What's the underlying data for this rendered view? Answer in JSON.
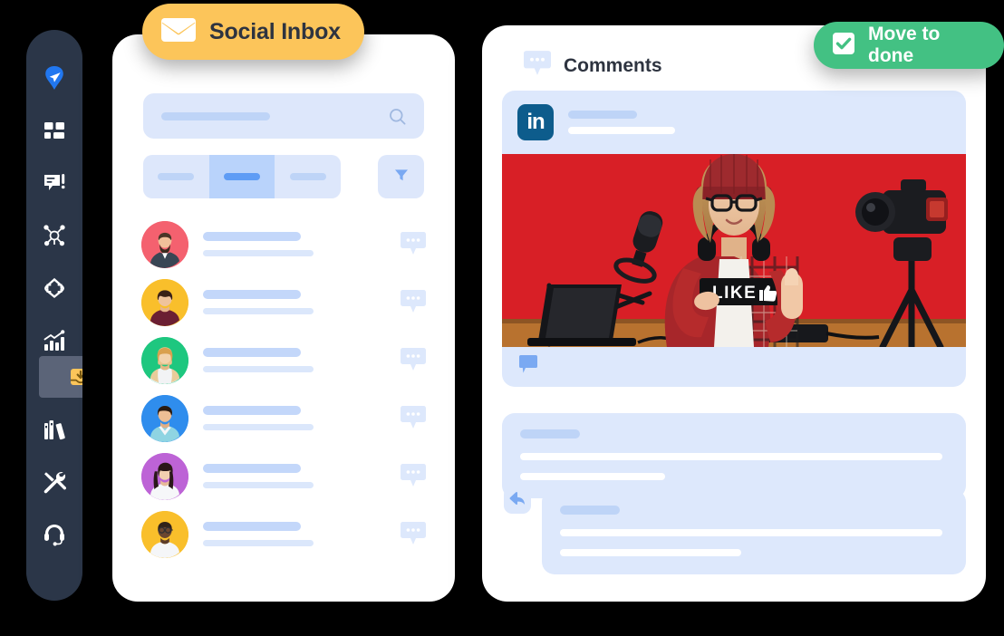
{
  "app": {
    "background_color": "#000000",
    "sidebar_color": "#2b3648",
    "sidebar_active_color": "#5b6478",
    "accent_yellow": "#fcc55a",
    "accent_green": "#43c183",
    "accent_blue": "#5e9cf5",
    "placeholder_blue": "#dde7fb"
  },
  "sidebar": {
    "name": "app-navigation-rail",
    "items": [
      {
        "icon": "paper-plane-icon",
        "label": "Publish",
        "active": false
      },
      {
        "icon": "dashboard-grid-icon",
        "label": "Dashboard",
        "active": false
      },
      {
        "icon": "comment-alert-icon",
        "label": "Engage",
        "active": false
      },
      {
        "icon": "network-nodes-icon",
        "label": "Network",
        "active": false
      },
      {
        "icon": "diamond-arrows-icon",
        "label": "Campaigns",
        "active": false
      },
      {
        "icon": "bar-chart-growth-icon",
        "label": "Analytics",
        "active": false
      },
      {
        "icon": "inbox-download-icon",
        "label": "Social Inbox",
        "active": true
      },
      {
        "icon": "books-library-icon",
        "label": "Library",
        "active": false
      },
      {
        "icon": "tools-wrench-icon",
        "label": "Tools",
        "active": false
      },
      {
        "icon": "headset-support-icon",
        "label": "Support",
        "active": false
      }
    ]
  },
  "inbox_badge": {
    "label": "Social Inbox",
    "icon": "envelope-icon"
  },
  "done_badge": {
    "label": "Move to done",
    "icon": "checkbox-checked-icon"
  },
  "left_panel": {
    "search": {
      "placeholder": "",
      "icon": "search-icon"
    },
    "tabs": [
      {
        "label": "",
        "active": false
      },
      {
        "label": "",
        "active": true
      },
      {
        "label": "",
        "active": false
      }
    ],
    "filter_button": {
      "label": "",
      "icon": "filter-funnel-icon"
    },
    "rows": [
      {
        "avatar": "avatar-bearded-man",
        "ring": "#f4616f",
        "title": "",
        "subtitle": "",
        "action_icon": "comment-bubble-icon"
      },
      {
        "avatar": "avatar-curly-hair-man",
        "ring": "#f9bf2b",
        "title": "",
        "subtitle": "",
        "action_icon": "comment-bubble-icon"
      },
      {
        "avatar": "avatar-blonde-woman",
        "ring": "#1ec77f",
        "title": "",
        "subtitle": "",
        "action_icon": "comment-bubble-icon"
      },
      {
        "avatar": "avatar-smiling-man",
        "ring": "#2f8ded",
        "title": "",
        "subtitle": "",
        "action_icon": "comment-bubble-icon"
      },
      {
        "avatar": "avatar-asian-woman",
        "ring": "#bd63d6",
        "title": "",
        "subtitle": "",
        "action_icon": "comment-bubble-icon"
      },
      {
        "avatar": "avatar-glasses-man",
        "ring": "#f9bf2b",
        "title": "",
        "subtitle": "",
        "action_icon": "comment-bubble-icon"
      }
    ]
  },
  "right_panel": {
    "header": {
      "title": "Comments",
      "icon": "comment-bubble-icon"
    },
    "post": {
      "network": "LinkedIn",
      "network_icon": "linkedin-icon",
      "network_mark": "in",
      "author_line": "",
      "meta_line": "",
      "image_alt": "Content creator in red beanie and plaid shirt holding a LIKE sign with thumbs up, in front of a red backdrop with microphone, laptop and camera on tripod",
      "reaction_icon": "reaction-bubble-icon"
    },
    "comment": {
      "author": "",
      "text_line_1": "",
      "text_line_2": ""
    },
    "reply": {
      "icon": "reply-arrow-icon",
      "author": "",
      "text_line_1": "",
      "text_line_2": ""
    }
  }
}
